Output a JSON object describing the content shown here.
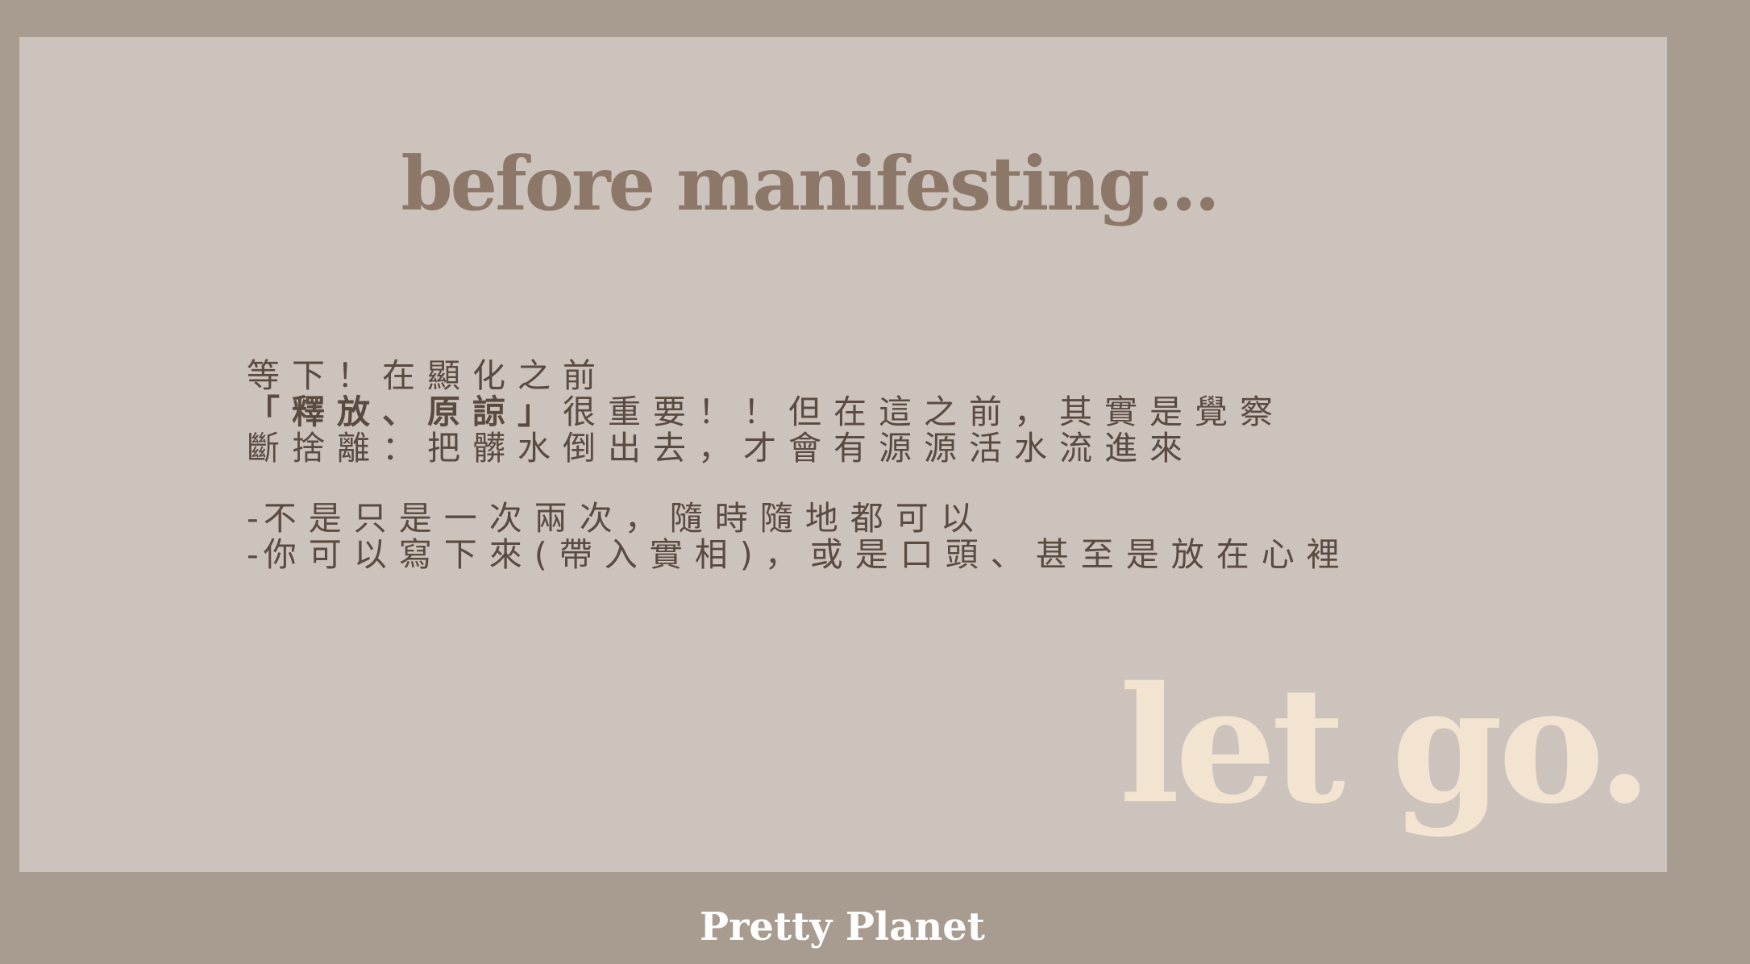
{
  "slide": {
    "title": "before manifesting...",
    "lines": {
      "l1": "等下！在顯化之前",
      "l2_bold": "「釋放、原諒」",
      "l2_rest": "很重要！！但在這之前，其實是覺察",
      "l3": "斷捨離：把髒水倒出去，才會有源源活水流進來",
      "b1_mark": "-",
      "b1": "不是只是一次兩次，隨時隨地都可以",
      "b2_mark": "-",
      "b2": "你可以寫下來(帶入實相)，或是口頭、甚至是放在心裡"
    },
    "accent_text": "let go.",
    "colors": {
      "background": "#a89b90",
      "slide": "#cdc3bd",
      "title": "#8c7769",
      "body": "#5a4b41",
      "accent": "#f3e4d2"
    }
  },
  "footer": {
    "brand": "Pretty Planet"
  }
}
